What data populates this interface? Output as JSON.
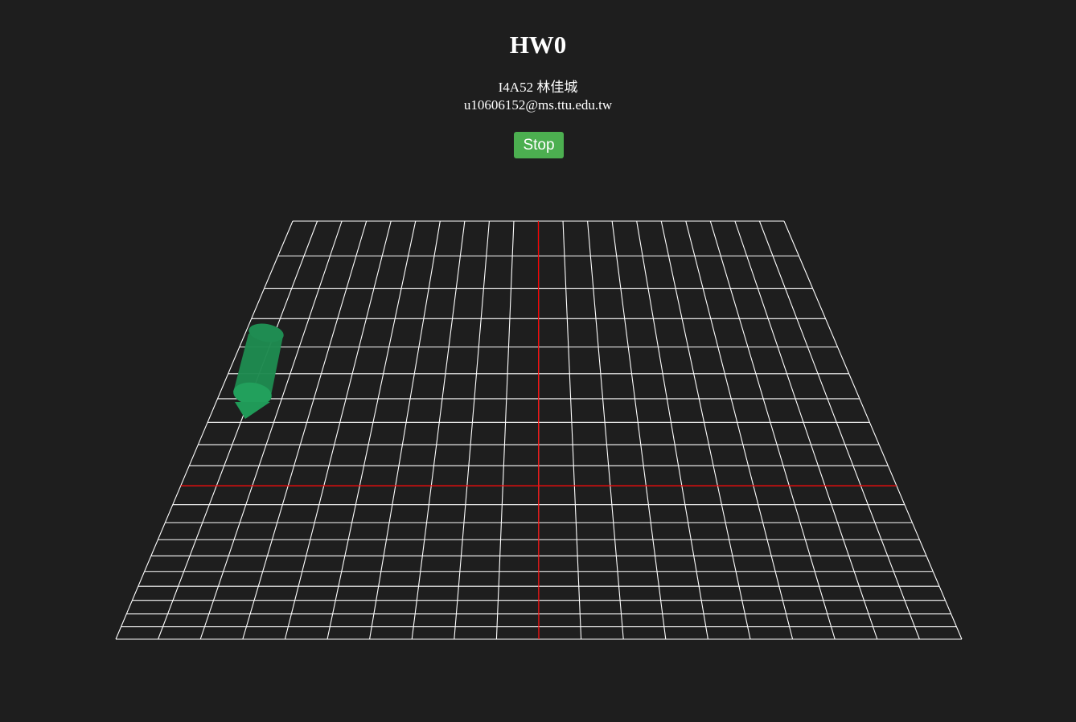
{
  "page": {
    "title": "HW0",
    "author": "I4A52 林佳城",
    "email": "u10606152@ms.ttu.edu.tw",
    "stop_label": "Stop"
  },
  "scene": {
    "grid_color": "#ffffff",
    "axis_color": "#ff0000",
    "background_color": "#1e1e1e",
    "object": "green-cylinder",
    "object_color": "#1e8c50"
  }
}
